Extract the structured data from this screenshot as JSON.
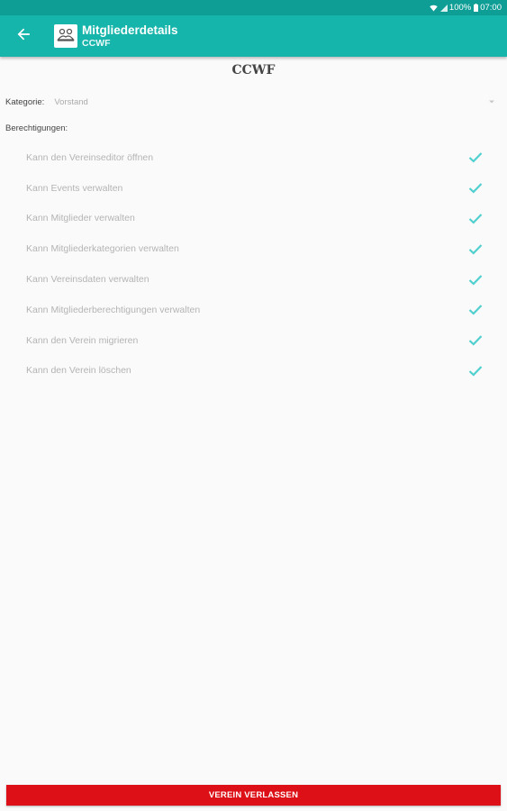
{
  "status_bar": {
    "battery": "100%",
    "time": "07:00",
    "icons": [
      "wifi-icon",
      "signal-icon",
      "battery-icon"
    ]
  },
  "app_bar": {
    "title": "Mitgliederdetails",
    "subtitle": "CCWF",
    "back_icon": "arrow-back-icon",
    "logo_icon": "members-icon"
  },
  "club": {
    "name": "CCWF"
  },
  "category": {
    "label": "Kategorie:",
    "value": "Vorstand",
    "dropdown_icon": "dropdown-arrow-icon"
  },
  "permissions": {
    "heading": "Berechtigungen:",
    "items": [
      {
        "label": "Kann den Vereinseditor öffnen",
        "checked": true
      },
      {
        "label": "Kann Events verwalten",
        "checked": true
      },
      {
        "label": "Kann Mitglieder verwalten",
        "checked": true
      },
      {
        "label": "Kann Mitgliederkategorien verwalten",
        "checked": true
      },
      {
        "label": "Kann Vereinsdaten verwalten",
        "checked": true
      },
      {
        "label": "Kann Mitgliederberechtigungen verwalten",
        "checked": true
      },
      {
        "label": "Kann den Verein migrieren",
        "checked": true
      },
      {
        "label": "Kann den Verein löschen",
        "checked": true
      }
    ]
  },
  "footer": {
    "leave_button": "VEREIN VERLASSEN"
  },
  "colors": {
    "status_bar": "#0e9e95",
    "app_bar": "#15b5ab",
    "check": "#4fd0cf",
    "leave_button": "#dc1016"
  }
}
